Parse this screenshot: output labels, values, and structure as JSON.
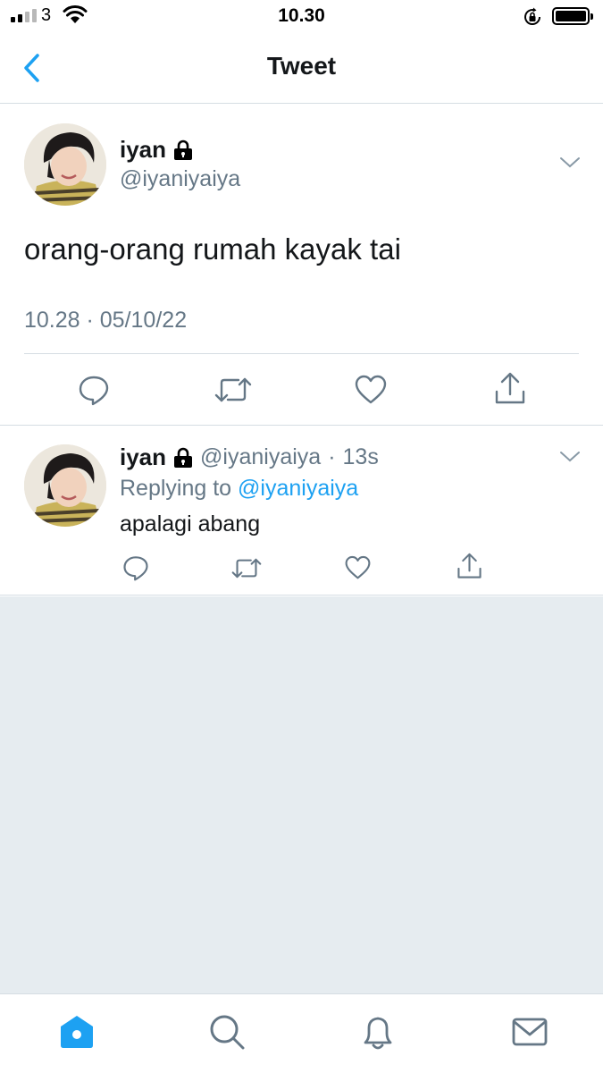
{
  "status_bar": {
    "carrier": "3",
    "time": "10.30"
  },
  "nav": {
    "title": "Tweet",
    "back_icon": "chevron-left-icon"
  },
  "tweet": {
    "name": "iyan",
    "handle": "@iyaniyaiya",
    "protected_icon": "lock-icon",
    "text": "orang-orang rumah kayak tai",
    "timestamp": "10.28 · 05/10/22",
    "actions": [
      "reply-icon",
      "retweet-icon",
      "like-icon",
      "share-icon"
    ]
  },
  "reply": {
    "name": "iyan",
    "handle": "@iyaniyaiya",
    "separator": "·",
    "age": "13s",
    "replying_prefix": "Replying to",
    "replying_to": "@iyaniyaiya",
    "text": "apalagi abang"
  },
  "tab_bar": {
    "items": [
      "home-icon",
      "search-icon",
      "notifications-icon",
      "messages-icon"
    ],
    "active": "home-icon"
  },
  "colors": {
    "accent": "#1da1f2",
    "text": "#14171a",
    "secondary_text": "#657786",
    "divider": "#d5dde3",
    "background_gray": "#e6ecf0"
  }
}
